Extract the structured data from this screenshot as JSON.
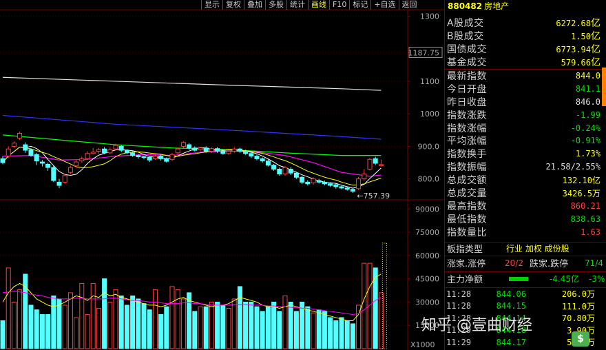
{
  "toolbar": {
    "buttons": [
      {
        "label": "显示"
      },
      {
        "label": "复权"
      },
      {
        "label": "叠加"
      },
      {
        "label": "多股"
      },
      {
        "label": "统计"
      },
      {
        "label": "画线",
        "active": true
      },
      {
        "label": "F10"
      },
      {
        "label": "标记"
      },
      {
        "label": "+自选"
      },
      {
        "label": "返回"
      }
    ]
  },
  "header": {
    "code": "880482",
    "name": "房地产"
  },
  "panel": {
    "rows_top": [
      {
        "label": "A股成交",
        "value": "6272.68",
        "unit": "亿",
        "color": "yellow"
      },
      {
        "label": "B股成交",
        "value": "1.50",
        "unit": "亿",
        "color": "yellow"
      },
      {
        "label": "国债成交",
        "value": "6773.94",
        "unit": "亿",
        "color": "yellow"
      },
      {
        "label": "基金成交",
        "value": "579.66",
        "unit": "亿",
        "color": "yellow"
      }
    ],
    "rows_main": [
      {
        "label": "最新指数",
        "value": "844.0",
        "color": "yellow"
      },
      {
        "label": "今日开盘",
        "value": "841.1",
        "color": "green"
      },
      {
        "label": "昨日收盘",
        "value": "846.0",
        "color": "white"
      },
      {
        "label": "指数涨跌",
        "value": "-1.99",
        "color": "green"
      },
      {
        "label": "指数涨幅",
        "value": "-0.24%",
        "color": "green"
      },
      {
        "label": "平均涨幅",
        "value": "-0.91%",
        "color": "green"
      },
      {
        "label": "指数换手",
        "value": "1.73%",
        "color": "yellow"
      },
      {
        "label": "指数振幅",
        "value": "21.58/2.55%",
        "color": "white"
      },
      {
        "label": "总成交额",
        "value": "132.10亿",
        "color": "yellow"
      },
      {
        "label": "总成交量",
        "value": "3426.5万",
        "color": "yellow"
      },
      {
        "label": "最高指数",
        "value": "860.21",
        "color": "red"
      },
      {
        "label": "最低指数",
        "value": "838.63",
        "color": "green"
      },
      {
        "label": "指数量比",
        "value": "1.63",
        "color": "red"
      }
    ],
    "type_row": {
      "label": "板指类型",
      "values": "行业 加权 成份股"
    },
    "rise_fall": {
      "label1": "涨家.涨停",
      "val1": "20/2",
      "label2": "跌家.跌停",
      "val2": "71/4"
    },
    "main_flow": {
      "label": "主力净额",
      "value": "-4.45亿",
      "pct": "-3%"
    },
    "ticks": [
      {
        "time": "11:28",
        "price": "844.06",
        "vol": "206.0万"
      },
      {
        "time": "11:28",
        "price": "844.15",
        "vol": "111.0万"
      },
      {
        "time": "11:28",
        "price": "844.14",
        "vol": "70.80万"
      },
      {
        "time": "11:29",
        "price": "844.18",
        "vol": "3.90万"
      },
      {
        "time": "11:29",
        "price": "844.17",
        "vol": "5.44万"
      }
    ]
  },
  "price_axis": {
    "ticks": [
      "1300",
      "1187.75",
      "1100",
      "1000",
      "900.0",
      "800.0"
    ],
    "min_label": "757.39"
  },
  "volume_axis": {
    "ticks": [
      "90000",
      "75000",
      "60000",
      "45000",
      "30000",
      "15000"
    ],
    "unit": "X1000"
  },
  "watermark": "知乎 @壹曲财经",
  "colors": {
    "up": "#ff4040",
    "down": "#54ffff",
    "ma5": "#ffffff",
    "ma10": "#ffff00",
    "ma20": "#ff00ff",
    "ma60": "#00ff00",
    "ma120": "#3030ff",
    "ma250": "#e0e0e0"
  },
  "chart_data": {
    "type": "candlestick",
    "price_ylim": [
      740,
      1320
    ],
    "volume_ylim": [
      0,
      95000
    ],
    "candles": [
      {
        "o": 862,
        "c": 850,
        "h": 870,
        "l": 845
      },
      {
        "o": 870,
        "c": 892,
        "h": 900,
        "l": 865
      },
      {
        "o": 900,
        "c": 910,
        "h": 915,
        "l": 895
      },
      {
        "o": 925,
        "c": 940,
        "h": 945,
        "l": 920
      },
      {
        "o": 905,
        "c": 888,
        "h": 912,
        "l": 880
      },
      {
        "o": 890,
        "c": 872,
        "h": 895,
        "l": 868
      },
      {
        "o": 875,
        "c": 855,
        "h": 880,
        "l": 842
      },
      {
        "o": 852,
        "c": 848,
        "h": 858,
        "l": 838
      },
      {
        "o": 845,
        "c": 835,
        "h": 850,
        "l": 825
      },
      {
        "o": 835,
        "c": 795,
        "h": 840,
        "l": 790
      },
      {
        "o": 790,
        "c": 780,
        "h": 800,
        "l": 772
      },
      {
        "o": 790,
        "c": 810,
        "h": 815,
        "l": 785
      },
      {
        "o": 820,
        "c": 835,
        "h": 840,
        "l": 815
      },
      {
        "o": 840,
        "c": 852,
        "h": 858,
        "l": 835
      },
      {
        "o": 855,
        "c": 862,
        "h": 868,
        "l": 850
      },
      {
        "o": 862,
        "c": 878,
        "h": 885,
        "l": 858
      },
      {
        "o": 878,
        "c": 882,
        "h": 895,
        "l": 875
      },
      {
        "o": 885,
        "c": 890,
        "h": 895,
        "l": 878
      },
      {
        "o": 892,
        "c": 880,
        "h": 898,
        "l": 876
      },
      {
        "o": 880,
        "c": 890,
        "h": 896,
        "l": 876
      },
      {
        "o": 892,
        "c": 903,
        "h": 908,
        "l": 888
      },
      {
        "o": 900,
        "c": 888,
        "h": 905,
        "l": 882
      },
      {
        "o": 888,
        "c": 880,
        "h": 892,
        "l": 876
      },
      {
        "o": 880,
        "c": 872,
        "h": 885,
        "l": 868
      },
      {
        "o": 872,
        "c": 868,
        "h": 876,
        "l": 862
      },
      {
        "o": 868,
        "c": 866,
        "h": 872,
        "l": 860
      },
      {
        "o": 866,
        "c": 858,
        "h": 870,
        "l": 852
      },
      {
        "o": 862,
        "c": 870,
        "h": 875,
        "l": 858
      },
      {
        "o": 870,
        "c": 862,
        "h": 874,
        "l": 856
      },
      {
        "o": 862,
        "c": 854,
        "h": 866,
        "l": 850
      },
      {
        "o": 860,
        "c": 875,
        "h": 880,
        "l": 855
      },
      {
        "o": 880,
        "c": 892,
        "h": 896,
        "l": 876
      },
      {
        "o": 900,
        "c": 912,
        "h": 916,
        "l": 895
      },
      {
        "o": 905,
        "c": 895,
        "h": 910,
        "l": 890
      },
      {
        "o": 895,
        "c": 888,
        "h": 900,
        "l": 884
      },
      {
        "o": 890,
        "c": 895,
        "h": 898,
        "l": 885
      },
      {
        "o": 895,
        "c": 885,
        "h": 900,
        "l": 880
      },
      {
        "o": 885,
        "c": 893,
        "h": 897,
        "l": 880
      },
      {
        "o": 893,
        "c": 885,
        "h": 898,
        "l": 880
      },
      {
        "o": 885,
        "c": 878,
        "h": 890,
        "l": 874
      },
      {
        "o": 878,
        "c": 885,
        "h": 890,
        "l": 874
      },
      {
        "o": 885,
        "c": 892,
        "h": 897,
        "l": 880
      },
      {
        "o": 892,
        "c": 885,
        "h": 896,
        "l": 880
      },
      {
        "o": 885,
        "c": 878,
        "h": 890,
        "l": 874
      },
      {
        "o": 878,
        "c": 870,
        "h": 883,
        "l": 865
      },
      {
        "o": 870,
        "c": 862,
        "h": 875,
        "l": 857
      },
      {
        "o": 862,
        "c": 855,
        "h": 866,
        "l": 850
      },
      {
        "o": 855,
        "c": 842,
        "h": 860,
        "l": 838
      },
      {
        "o": 842,
        "c": 830,
        "h": 846,
        "l": 825
      },
      {
        "o": 830,
        "c": 815,
        "h": 835,
        "l": 810
      },
      {
        "o": 815,
        "c": 835,
        "h": 840,
        "l": 810
      },
      {
        "o": 830,
        "c": 818,
        "h": 836,
        "l": 812
      },
      {
        "o": 818,
        "c": 805,
        "h": 822,
        "l": 800
      },
      {
        "o": 805,
        "c": 790,
        "h": 810,
        "l": 785
      },
      {
        "o": 790,
        "c": 785,
        "h": 796,
        "l": 780
      },
      {
        "o": 788,
        "c": 800,
        "h": 805,
        "l": 782
      },
      {
        "o": 795,
        "c": 790,
        "h": 800,
        "l": 786
      },
      {
        "o": 790,
        "c": 785,
        "h": 795,
        "l": 780
      },
      {
        "o": 785,
        "c": 780,
        "h": 790,
        "l": 775
      },
      {
        "o": 782,
        "c": 776,
        "h": 786,
        "l": 770
      },
      {
        "o": 776,
        "c": 772,
        "h": 780,
        "l": 768
      },
      {
        "o": 772,
        "c": 768,
        "h": 776,
        "l": 764
      },
      {
        "o": 768,
        "c": 762,
        "h": 772,
        "l": 757
      },
      {
        "o": 770,
        "c": 800,
        "h": 806,
        "l": 766
      },
      {
        "o": 800,
        "c": 815,
        "h": 830,
        "l": 795
      },
      {
        "o": 830,
        "c": 860,
        "h": 865,
        "l": 826
      },
      {
        "o": 862,
        "c": 848,
        "h": 868,
        "l": 842
      },
      {
        "o": 841,
        "c": 844,
        "h": 860,
        "l": 838
      }
    ],
    "volumes": [
      18000,
      52000,
      30000,
      38000,
      48000,
      28000,
      25000,
      22000,
      22000,
      34000,
      32000,
      28000,
      36000,
      20000,
      42000,
      22000,
      42000,
      26000,
      45000,
      30000,
      38000,
      34000,
      28000,
      34000,
      32000,
      29000,
      25000,
      38000,
      22000,
      27000,
      40000,
      38000,
      32000,
      36000,
      24000,
      27000,
      27000,
      30000,
      30000,
      28000,
      26000,
      32000,
      40000,
      30000,
      30000,
      27000,
      24000,
      27000,
      30000,
      24000,
      34000,
      30000,
      24000,
      30000,
      27000,
      23000,
      25000,
      24000,
      20000,
      18000,
      20000,
      18000,
      16000,
      28000,
      55000,
      55000,
      52000,
      36000
    ],
    "ma_lines": [
      {
        "name": "MA250",
        "color": "#e0e0e0",
        "points": [
          [
            0,
            1112
          ],
          [
            20,
            1100
          ],
          [
            40,
            1088
          ],
          [
            60,
            1077
          ],
          [
            67,
            1072
          ]
        ]
      },
      {
        "name": "MA120",
        "color": "#3030ff",
        "points": [
          [
            0,
            995
          ],
          [
            20,
            968
          ],
          [
            40,
            950
          ],
          [
            60,
            930
          ],
          [
            67,
            922
          ]
        ]
      },
      {
        "name": "MA60",
        "color": "#00ff00",
        "points": [
          [
            0,
            935
          ],
          [
            10,
            920
          ],
          [
            20,
            905
          ],
          [
            30,
            895
          ],
          [
            40,
            890
          ],
          [
            50,
            880
          ],
          [
            60,
            872
          ],
          [
            67,
            872
          ]
        ]
      },
      {
        "name": "MA20",
        "color": "#ff00ff",
        "points": [
          [
            0,
            870
          ],
          [
            5,
            872
          ],
          [
            10,
            858
          ],
          [
            15,
            860
          ],
          [
            20,
            870
          ],
          [
            25,
            875
          ],
          [
            30,
            872
          ],
          [
            35,
            882
          ],
          [
            40,
            886
          ],
          [
            45,
            883
          ],
          [
            50,
            872
          ],
          [
            55,
            850
          ],
          [
            60,
            820
          ],
          [
            65,
            808
          ],
          [
            67,
            812
          ]
        ]
      }
    ],
    "vol_ma": [
      {
        "name": "VMA5",
        "color": "#ffff00",
        "values": [
          30000,
          36000,
          40000,
          42000,
          40000,
          36000,
          32000,
          30000,
          28000,
          27000,
          28000,
          30000,
          32000,
          34000,
          33000,
          31000,
          34000,
          33000,
          36000,
          34000,
          35000,
          33000,
          32000,
          31000,
          30000,
          29000,
          28000,
          28000,
          27000,
          28000,
          30000,
          32000,
          33000,
          31000,
          30000,
          29000,
          28000,
          27000,
          28000,
          28000,
          29000,
          31000,
          33000,
          32000,
          31000,
          30000,
          28000,
          27000,
          27000,
          26000,
          27000,
          28000,
          27000,
          26000,
          25000,
          24000,
          23000,
          22000,
          21000,
          20000,
          19000,
          18000,
          18000,
          22000,
          32000,
          40000,
          46000,
          48000
        ]
      },
      {
        "name": "VMA10",
        "color": "#ff00ff",
        "values": [
          36000,
          36500,
          37000,
          36500,
          36000,
          35000,
          34500,
          34000,
          33000,
          32500,
          32000,
          32000,
          32000,
          32500,
          32500,
          32000,
          32000,
          32000,
          32000,
          32500,
          32500,
          32000,
          31500,
          31000,
          31000,
          30500,
          30000,
          30000,
          29500,
          29000,
          29000,
          29000,
          29500,
          29500,
          29000,
          29000,
          28500,
          28000,
          28000,
          28000,
          28000,
          28500,
          28500,
          28500,
          28000,
          28000,
          28000,
          27500,
          27500,
          27000,
          27000,
          26500,
          26500,
          26000,
          26000,
          25500,
          25000,
          24500,
          24000,
          23500,
          23000,
          22500,
          22000,
          22500,
          25000,
          28000,
          31000,
          33000
        ]
      }
    ]
  }
}
